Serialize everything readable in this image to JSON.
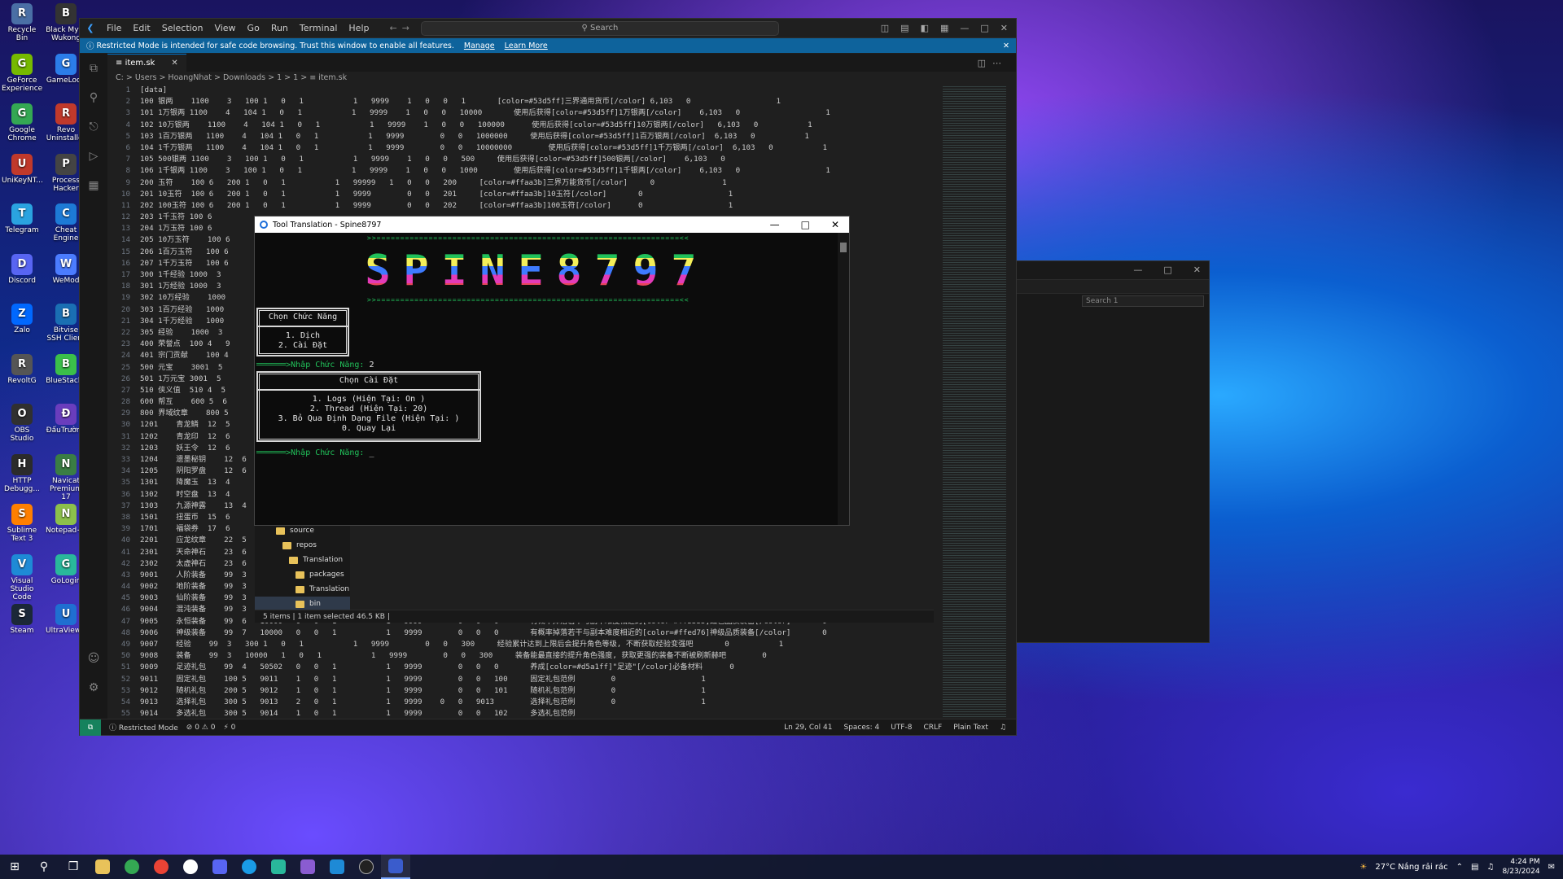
{
  "desktop_icons": [
    "Recycle Bin",
    "Black Myth Wukong",
    "GeForce Experience",
    "GameLoop",
    "Google Chrome",
    "Revo Uninstaller",
    "UniKeyNT...",
    "Process Hacker",
    "Telegram",
    "Cheat Engine",
    "Discord",
    "WeMod",
    "Zalo",
    "Bitvise SSH Client",
    "RevoltG",
    "BlueStacks",
    "OBS Studio",
    "ĐấuTrường",
    "HTTP Debugg...",
    "Navicat Premium 17",
    "Sublime Text 3",
    "Notepad++",
    "Visual Studio Code",
    "GoLogin",
    "Steam",
    "UltraViewer"
  ],
  "vscode": {
    "menu": [
      "File",
      "Edit",
      "Selection",
      "View",
      "Go",
      "Run",
      "Terminal",
      "Help"
    ],
    "search_placeholder": "Search",
    "banner_text": "Restricted Mode is intended for safe code browsing. Trust this window to enable all features.",
    "banner_manage": "Manage",
    "banner_learn": "Learn More",
    "tab_label": "item.sk",
    "breadcrumb": "C: > Users > HoangNhat > Downloads > 1 > 1 > ≡ item.sk",
    "code_lines": [
      {
        "n": "1",
        "t": "[data]"
      },
      {
        "n": "2",
        "t": "100 银两    1100    3   100 1   0   1           1   9999    1   0   0   1       [color=#53d5ff]三界通用货币[/color] 6,103   0                   1"
      },
      {
        "n": "3",
        "t": "101 1万银两 1100    4   104 1   0   1           1   9999    1   0   0   10000       使用后获得[color=#53d5ff]1万银两[/color]    6,103   0                   1"
      },
      {
        "n": "4",
        "t": "102 10万银两    1100    4   104 1   0   1           1   9999    1   0   0   100000      使用后获得[color=#53d5ff]10万银两[/color]   6,103   0           1"
      },
      {
        "n": "5",
        "t": "103 1百万银两   1100    4   104 1   0   1           1   9999        0   0   1000000     使用后获得[color=#53d5ff]1百万银两[/color]  6,103   0           1"
      },
      {
        "n": "6",
        "t": "104 1千万银两   1100    4   104 1   0   1           1   9999        0   0   10000000        使用后获得[color=#53d5ff]1千万银两[/color]  6,103   0           1"
      },
      {
        "n": "7",
        "t": "105 500银两 1100    3   100 1   0   1           1   9999    1   0   0   500     使用后获得[color=#53d5ff]500银两[/color]    6,103   0"
      },
      {
        "n": "8",
        "t": "106 1千银两 1100    3   100 1   0   1           1   9999    1   0   0   1000        使用后获得[color=#53d5ff]1千银两[/color]    6,103   0                   1"
      },
      {
        "n": "9",
        "t": "200 玉符    100 6   200 1   0   1           1   99999   1   0   0   200     [color=#ffaa3b]三界万能货币[/color]     0               1"
      },
      {
        "n": "10",
        "t": "201 10玉符  100 6   200 1   0   1           1   9999        0   0   201     [color=#ffaa3b]10玉符[/color]       0                   1"
      },
      {
        "n": "11",
        "t": "202 100玉符 100 6   200 1   0   1           1   9999        0   0   202     [color=#ffaa3b]100玉符[/color]      0                   1"
      },
      {
        "n": "12",
        "t": "203 1千玉符 100 6"
      },
      {
        "n": "13",
        "t": "204 1万玉符 100 6"
      },
      {
        "n": "14",
        "t": "205 10万玉符    100 6"
      },
      {
        "n": "15",
        "t": "206 1百万玉符   100 6"
      },
      {
        "n": "16",
        "t": "207 1千万玉符   100 6"
      },
      {
        "n": "17",
        "t": "300 1千经验 1000  3"
      },
      {
        "n": "18",
        "t": "301 1万经验 1000  3"
      },
      {
        "n": "19",
        "t": "302 10万经验    1000"
      },
      {
        "n": "20",
        "t": "303 1百万经验   1000"
      },
      {
        "n": "21",
        "t": "304 1千万经验   1000"
      },
      {
        "n": "22",
        "t": "305 经验    1000  3"
      },
      {
        "n": "23",
        "t": "400 荣誉点  100 4   9"
      },
      {
        "n": "24",
        "t": "401 宗门贡献    100 4"
      },
      {
        "n": "25",
        "t": "500 元宝    3001  5"
      },
      {
        "n": "26",
        "t": "501 1万元宝 3001  5"
      },
      {
        "n": "27",
        "t": "510 侠义值  510 4  5"
      },
      {
        "n": "28",
        "t": "600 帮互    600 5  6"
      },
      {
        "n": "29",
        "t": "800 界域纹章    800 5"
      },
      {
        "n": "30",
        "t": "1201    青龙鳞  12  5"
      },
      {
        "n": "31",
        "t": "1202    青龙印  12  6"
      },
      {
        "n": "32",
        "t": "1203    妖王令  12  6"
      },
      {
        "n": "33",
        "t": "1204    遗墨秘钥    12  6"
      },
      {
        "n": "34",
        "t": "1205    阴阳罗盘    12  6"
      },
      {
        "n": "35",
        "t": "1301    降魔玉  13  4"
      },
      {
        "n": "36",
        "t": "1302    时空盘  13  4"
      },
      {
        "n": "37",
        "t": "1303    九源神露    13  4"
      },
      {
        "n": "38",
        "t": "1501    扭蛋币  15  6"
      },
      {
        "n": "39",
        "t": "1701    福袋券  17  6"
      },
      {
        "n": "40",
        "t": "2201    应龙纹章    22  5"
      },
      {
        "n": "41",
        "t": "2301    天命神石    23  6"
      },
      {
        "n": "42",
        "t": "2302    太虚神石    23  6"
      },
      {
        "n": "43",
        "t": "9001    人阶装备    99  3"
      },
      {
        "n": "44",
        "t": "9002    地阶装备    99  3"
      },
      {
        "n": "45",
        "t": "9003    仙阶装备    99  3"
      },
      {
        "n": "46",
        "t": "9004    混沌装备    99  3"
      },
      {
        "n": "47",
        "t": "9005    永恒装备    99  6   10000   0   0   1           1   9999        0   0   0       有概率掉落若干与副本难度相近的[color=#ff3535]红色品质装备[/color]       0"
      },
      {
        "n": "48",
        "t": "9006    神级装备    99  7   10000   0   0   1           1   9999        0   0   0       有概率掉落若干与副本难度相近的[color=#ffed76]神级品质装备[/color]       0"
      },
      {
        "n": "49",
        "t": "9007    经验    99  3   300 1   0   1           1   9999        0   0   300     经验累计达到上限后会提升角色等级, 不断获取经验变强吧       0           1"
      },
      {
        "n": "50",
        "t": "9008    装备    99  3   10000   1   0   1           1   9999        0   0   300     装备能最直接的提升角色强度, 获取更强的装备不断被刷新赫吧        0"
      },
      {
        "n": "51",
        "t": "9009    足迹礼包    99  4   50502   0   0   1           1   9999        0   0   0       养成[color=#d5a1ff]\"足迹\"[/color]必备材料      0"
      },
      {
        "n": "52",
        "t": "9011    固定礼包    100 5   9011    1   0   1           1   9999        0   0   100     固定礼包范例        0                   1"
      },
      {
        "n": "53",
        "t": "9012    随机礼包    200 5   9012    1   0   1           1   9999        0   0   101     随机礼包范例        0                   1"
      },
      {
        "n": "54",
        "t": "9013    选择礼包    300 5   9013    2   0   1           1   9999    0   0   9013        选择礼包范例        0                   1"
      },
      {
        "n": "55",
        "t": "9014    多选礼包    300 5   9014    1   0   1           1   9999        0   0   102     多选礼包范例"
      }
    ],
    "status": {
      "restricted": "Restricted Mode",
      "problems": "⊘ 0 ⚠ 0",
      "ports": "⚡ 0",
      "position": "Ln 29, Col 41",
      "spaces": "Spaces: 4",
      "encoding": "UTF-8",
      "eol": "CRLF",
      "language": "Plain Text"
    }
  },
  "explorer": {
    "tree": [
      "source",
      "repos",
      "Translation",
      "packages",
      "Translation",
      "bin"
    ],
    "status": "5 items  |  1 item selected  46.5 KB  |",
    "search_placeholder": "Search 1"
  },
  "console": {
    "title": "Tool Translation - Spine8797",
    "banner_text": "SPINE8797",
    "menu_title": "Chọn Chức Năng",
    "menu_items": [
      "1. Dịch",
      "2. Cài Đặt"
    ],
    "prompt1": "══════>Nhập Chức Năng: ",
    "input1": "2",
    "settings_title": "Chọn Cài Đặt",
    "settings_items": [
      "1. Logs (Hiện Tại: On )",
      "2. Thread (Hiện Tại: 20)",
      "3. Bỏ Qua Định Dạng File (Hiện Tại: )",
      "0. Quay Lại"
    ],
    "prompt2": "══════>Nhập Chức Năng: "
  },
  "taskbar": {
    "weather": "27°C  Nắng rải rác",
    "time": "4:24 PM",
    "date": "8/23/2024"
  }
}
